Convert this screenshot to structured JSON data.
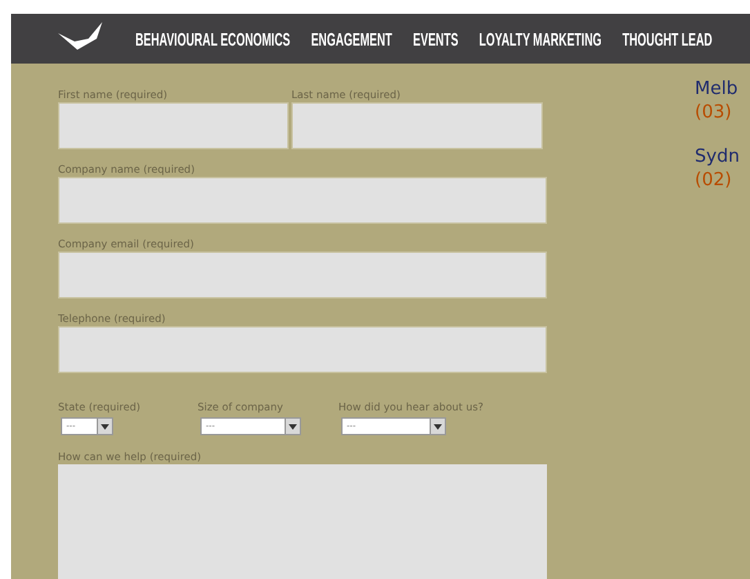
{
  "nav": {
    "items": [
      "BEHAVIOURAL ECONOMICS",
      "ENGAGEMENT",
      "EVENTS",
      "LOYALTY MARKETING",
      "THOUGHT LEAD"
    ]
  },
  "form": {
    "name_row": [
      {
        "label": "First name (required)"
      },
      {
        "label": "Last name (required)"
      }
    ],
    "fields": [
      {
        "label": "Company name (required)"
      },
      {
        "label": "Company email (required)"
      },
      {
        "label": "Telephone (required)"
      }
    ],
    "selects": [
      {
        "label": "State (required)",
        "value": "---"
      },
      {
        "label": "Size of company",
        "value": "---"
      },
      {
        "label": "How did you hear about us?",
        "value": "---"
      }
    ],
    "message": {
      "label": "How can we help (required)"
    }
  },
  "offices": [
    {
      "city": "Melb",
      "phone": "(03)"
    },
    {
      "city": "Sydn",
      "phone": "(02)"
    }
  ]
}
